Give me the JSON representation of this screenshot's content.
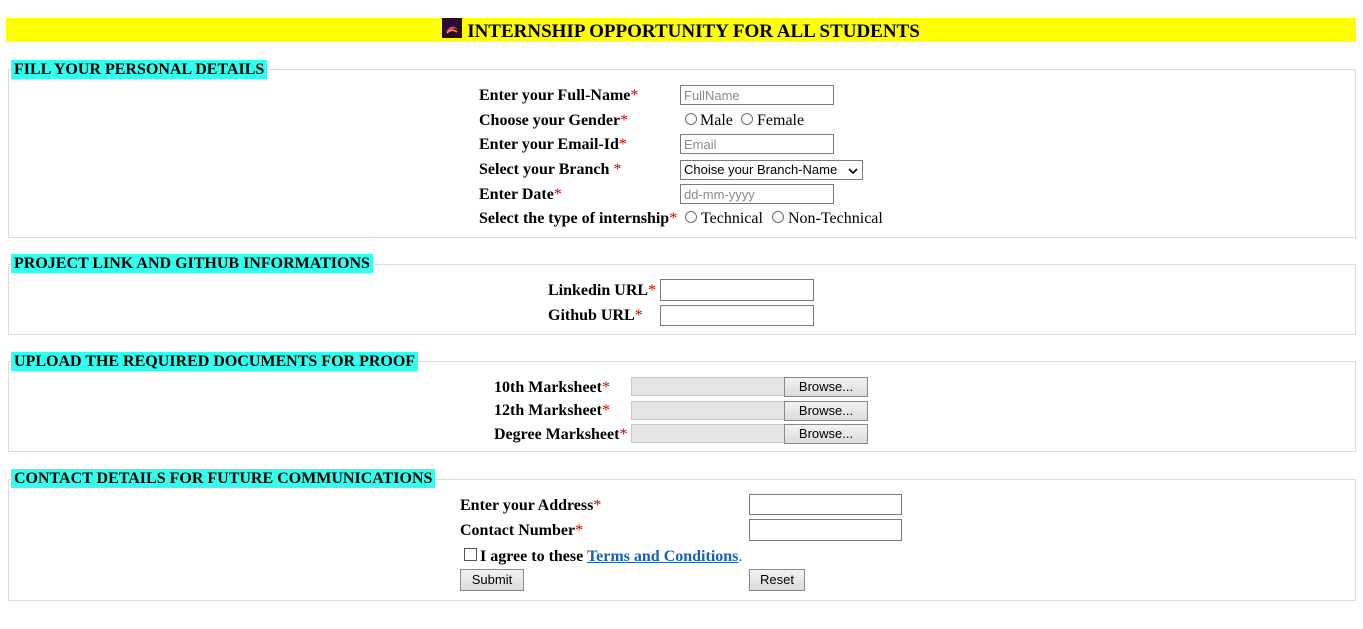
{
  "banner": {
    "title": "INTERNSHIP OPPORTUNITY FOR ALL STUDENTS",
    "logo": "fire-logo-icon"
  },
  "personal": {
    "legend": "FILL YOUR PERSONAL DETAILS",
    "fullname_label": "Enter your Full-Name",
    "fullname_placeholder": "FullName",
    "gender_label": "Choose your Gender",
    "gender_male": "Male",
    "gender_female": "Female",
    "email_label": "Enter your Email-Id",
    "email_placeholder": "Email",
    "branch_label": "Select your Branch ",
    "branch_selected": "Choise your Branch-Name",
    "date_label": "Enter Date",
    "date_placeholder": "dd-mm-yyyy",
    "type_label": "Select the type of internship",
    "type_technical": "Technical",
    "type_nontechnical": "Non-Technical"
  },
  "project": {
    "legend": "PROJECT LINK AND GITHUB INFORMATIONS",
    "linkedin_label": "Linkedin URL",
    "github_label": "Github URL"
  },
  "upload": {
    "legend": "UPLOAD THE REQUIRED DOCUMENTS FOR PROOF",
    "tenth_label": "10th Marksheet",
    "twelfth_label": "12th Marksheet",
    "degree_label": "Degree Marksheet",
    "browse_label": "Browse..."
  },
  "contact": {
    "legend": "CONTACT DETAILS FOR FUTURE COMMUNICATIONS",
    "address_label": "Enter your Address",
    "phone_label": "Contact Number",
    "agree_text": "I agree to these ",
    "terms_link": "Terms and Conditions",
    "agree_end": ".",
    "submit_label": "Submit",
    "reset_label": "Reset"
  },
  "required_mark": "*",
  "colors": {
    "banner": "#ffff00",
    "legend": "#33ffee",
    "required": "#d40000",
    "link": "#1a5fb4"
  }
}
